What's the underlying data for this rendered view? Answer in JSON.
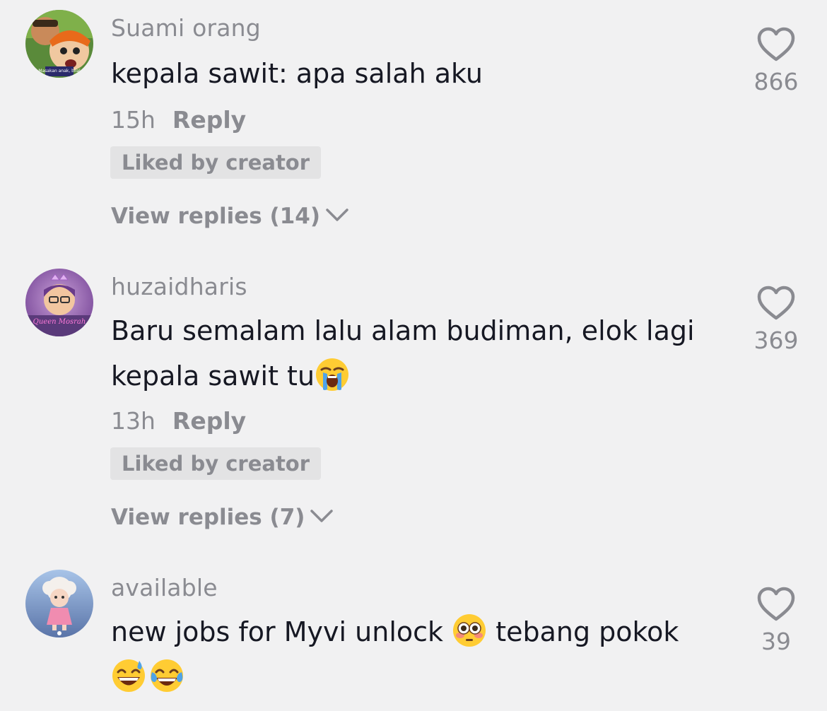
{
  "comments": [
    {
      "username": "Suami orang",
      "text": "kepala sawit: apa salah aku",
      "time": "15h",
      "reply_label": "Reply",
      "liked_label": "Liked by creator",
      "view_replies_label": "View replies (14)",
      "likes": "866",
      "avatar_caption": "Masakan anak, bilal"
    },
    {
      "username": "huzaidharis",
      "text_line1": "Baru semalam lalu alam budiman, elok lagi",
      "text_line2": "kepala sawit tu",
      "time": "13h",
      "reply_label": "Reply",
      "liked_label": "Liked by creator",
      "view_replies_label": "View replies (7)",
      "likes": "369",
      "avatar_caption": "Queen Mosrah"
    },
    {
      "username": "available",
      "text_part1": "new jobs for Myvi unlock ",
      "text_part2": " tebang pokok",
      "likes": "39"
    }
  ],
  "icons": {
    "like": "heart-outline-icon",
    "expand": "chevron-down-icon",
    "emoji_crying": "loudly-crying-face-emoji",
    "emoji_flushed": "flushed-face-emoji",
    "emoji_sweat": "grinning-face-with-sweat-emoji",
    "emoji_tears": "face-with-tears-of-joy-emoji"
  },
  "colors": {
    "background": "#f1f1f2",
    "text_primary": "#161823",
    "text_secondary": "#8a8b91",
    "badge_bg": "#e3e3e4"
  }
}
